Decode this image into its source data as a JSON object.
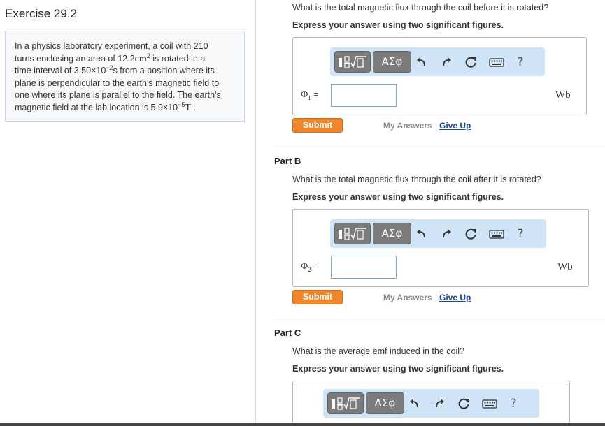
{
  "exercise": {
    "title": "Exercise 29.2",
    "problem": {
      "line1": "In a physics laboratory experiment, a coil with 210",
      "line2_pre": "turns enclosing an area of 12.2",
      "area_unit": "cm",
      "area_exp": "2",
      "line2_post": " is rotated in a",
      "line3_pre": "time interval of 3.50×10",
      "time_exp": "−2",
      "line3_post": "s from a position where its",
      "line4": "plane is perpendicular to the earth's magnetic field to",
      "line5": "one where its plane is parallel to the field. The earth's",
      "line6_pre": "magnetic field at the lab location is 5.9×10",
      "field_exp": "−5",
      "field_unit": "T",
      "line6_post": " ."
    }
  },
  "toolbar": {
    "symbols_label": "ΑΣφ",
    "template_icon": "templates-sqrt-icon",
    "undo_icon": "undo-icon",
    "redo_icon": "redo-icon",
    "reset_icon": "reset-icon",
    "keyboard_icon": "keyboard-icon",
    "help_label": "?"
  },
  "parts": [
    {
      "title": "",
      "question": "What is the total magnetic flux through the coil before it is rotated?",
      "instruction": "Express your answer using two significant figures.",
      "variable": "Φ",
      "subscript": "1",
      "equals": "=",
      "value": "",
      "unit": "Wb",
      "submit_label": "Submit",
      "my_answers_label": "My Answers",
      "give_up_label": "Give Up"
    },
    {
      "title": "Part B",
      "question": "What is the total magnetic flux through the coil after it is rotated?",
      "instruction": "Express your answer using two significant figures.",
      "variable": "Φ",
      "subscript": "2",
      "equals": "=",
      "value": "",
      "unit": "Wb",
      "submit_label": "Submit",
      "my_answers_label": "My Answers",
      "give_up_label": "Give Up"
    },
    {
      "title": "Part C",
      "question": "What is the average emf induced in the coil?",
      "instruction": "Express your answer using two significant figures."
    }
  ],
  "colors": {
    "submit": "#f1862b",
    "toolbar_bg": "#cfe4f7",
    "link": "#1a46a3"
  }
}
